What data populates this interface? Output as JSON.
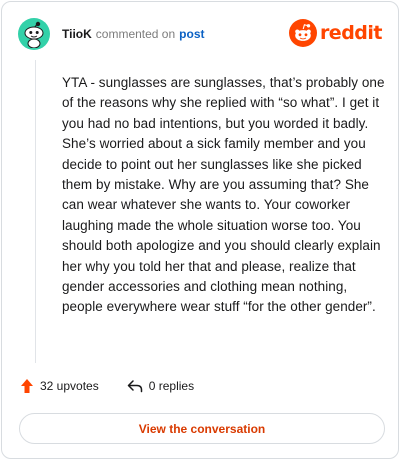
{
  "header": {
    "username": "TiioK",
    "action_text": "commented on",
    "post_link": "post",
    "brand_wordmark": "reddit"
  },
  "comment": {
    "body": "YTA - sunglasses are sunglasses, that’s probably one of the reasons why she replied with “so what”. I get it you had no bad intentions, but you worded it badly. She’s worried about a sick family member and you decide to point out her sunglasses like she picked them by mistake. Why are you assuming that? She can wear whatever she wants to. Your coworker laughing made the whole situation worse too. You should both apologize and you should clearly explain her why you told her that and please, realize that gender accessories and clothing mean nothing, people everywhere wear stuff “for the other gender”."
  },
  "footer": {
    "upvotes": "32 upvotes",
    "replies": "0 replies",
    "view_conversation": "View the conversation"
  },
  "icons": {
    "avatar": "snoo-avatar-icon",
    "brand": "reddit-logo-icon",
    "upvote": "upvote-arrow-icon",
    "reply": "reply-arrow-icon"
  },
  "colors": {
    "avatar_bg": "#33d1a9",
    "brand": "#ff4500",
    "link": "#0b61c4",
    "upvote": "#ff4500",
    "cta": "#d93a00"
  }
}
